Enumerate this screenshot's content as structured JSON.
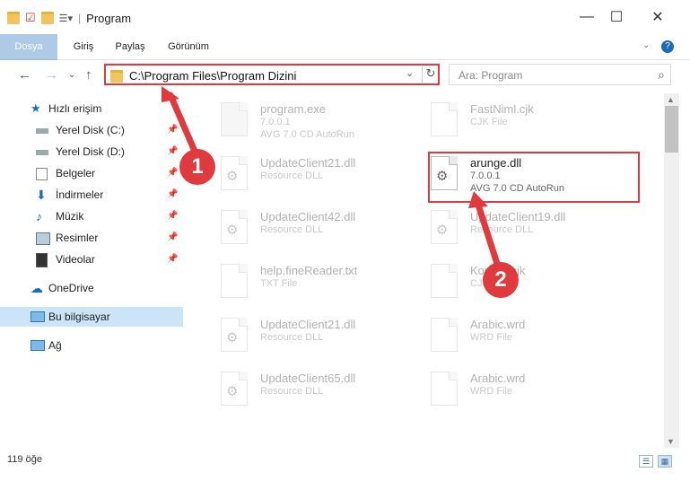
{
  "window": {
    "title": "Program",
    "minimize": "—",
    "maximize": "☐",
    "close": "✕"
  },
  "ribbon": {
    "tabs": [
      "Dosya",
      "Giriş",
      "Paylaş",
      "Görünüm"
    ],
    "help": "?"
  },
  "address": {
    "path": "C:\\Program Files\\Program Dizini",
    "refresh": "↻",
    "dropdown": "⌄"
  },
  "search": {
    "placeholder": "Ara: Program"
  },
  "sidebar": {
    "items": [
      {
        "label": "Hızlı erişim",
        "icon": "star-icon"
      },
      {
        "label": "Yerel Disk (C:)",
        "icon": "drive-icon",
        "pinned": true
      },
      {
        "label": "Yerel Disk (D:)",
        "icon": "drive-icon",
        "pinned": true
      },
      {
        "label": "Belgeler",
        "icon": "documents-icon",
        "pinned": true
      },
      {
        "label": "İndirmeler",
        "icon": "download-icon",
        "pinned": true
      },
      {
        "label": "Müzik",
        "icon": "music-icon",
        "pinned": true
      },
      {
        "label": "Resimler",
        "icon": "pictures-icon",
        "pinned": true
      },
      {
        "label": "Videolar",
        "icon": "video-icon",
        "pinned": true
      },
      {
        "label": "OneDrive",
        "icon": "cloud-icon"
      },
      {
        "label": "Bu bilgisayar",
        "icon": "computer-icon",
        "selected": true
      },
      {
        "label": "Ağ",
        "icon": "network-icon"
      }
    ]
  },
  "files": [
    {
      "name": "program.exe",
      "line2": "7.0.0.1",
      "line3": "AVG 7.0 CD AutoRun"
    },
    {
      "name": "FastNiml.cjk",
      "line2": "CJK File",
      "line3": ""
    },
    {
      "name": "UpdateClient21.dll",
      "line2": "Resource DLL",
      "line3": ""
    },
    {
      "name": "arunge.dll",
      "line2": "7.0.0.1",
      "line3": "AVG 7.0 CD AutoRun",
      "highlight": true
    },
    {
      "name": "UpdateClient42.dll",
      "line2": "Resource DLL",
      "line3": ""
    },
    {
      "name": "UpdateClient19.dll",
      "line2": "Resource DLL",
      "line3": ""
    },
    {
      "name": "help.fineReader.txt",
      "line2": "TXT File",
      "line3": ""
    },
    {
      "name": "Korean.cjk",
      "line2": "CJK File",
      "line3": ""
    },
    {
      "name": "UpdateClient21.dll",
      "line2": "Resource DLL",
      "line3": ""
    },
    {
      "name": "Arabic.wrd",
      "line2": "WRD File",
      "line3": ""
    },
    {
      "name": "UpdateClient65.dll",
      "line2": "Resource DLL",
      "line3": ""
    },
    {
      "name": "Arabic.wrd",
      "line2": "WRD File",
      "line3": ""
    }
  ],
  "status": {
    "count": "119 öğe"
  },
  "annotations": {
    "badge1": "1",
    "badge2": "2",
    "color": "#e0393e"
  }
}
